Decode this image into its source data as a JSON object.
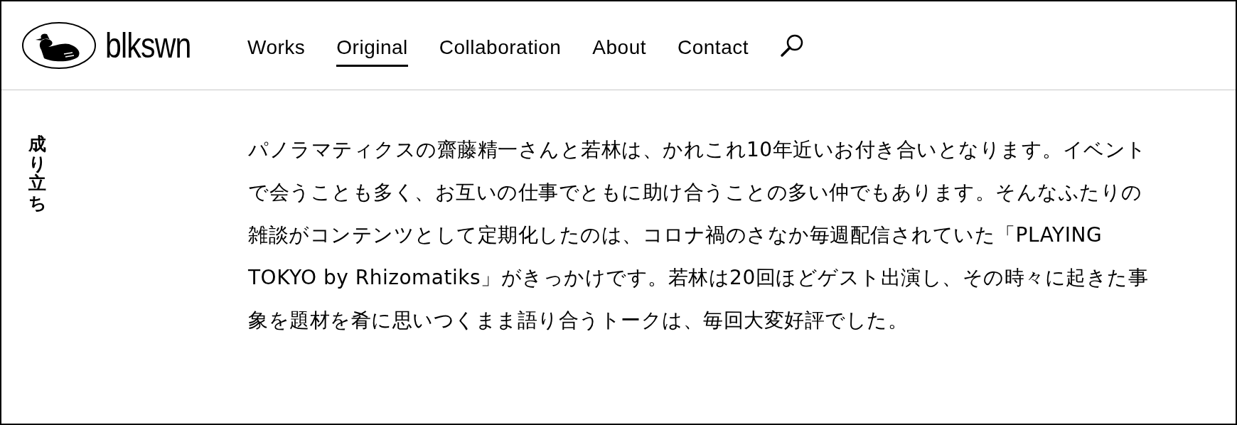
{
  "header": {
    "logo": {
      "text": "blkswn"
    },
    "nav": [
      {
        "label": "Works",
        "selected": false
      },
      {
        "label": "Original",
        "selected": true
      },
      {
        "label": "Collaboration",
        "selected": false
      },
      {
        "label": "About",
        "selected": false
      },
      {
        "label": "Contact",
        "selected": false
      }
    ]
  },
  "section": {
    "heading": "成り立ち",
    "body": "パノラマティクスの齋藤精一さんと若林は、かれこれ10年近いお付き合いとなります。イベントで会うことも多く、お互いの仕事でともに助け合うことの多い仲でもあります。そんなふたりの雑談がコンテンツとして定期化したのは、コロナ禍のさなか毎週配信されていた「PLAYING TOKYO by Rhizomatiks」がきっかけです。若林は20回ほどゲスト出演し、その時々に起きた事象を題材を肴に思いつくまま語り合うトークは、毎回大変好評でした。"
  }
}
